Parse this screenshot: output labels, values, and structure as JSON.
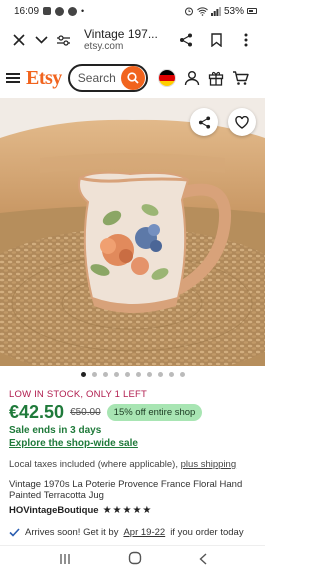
{
  "status_bar": {
    "time": "16:09",
    "battery": "53%"
  },
  "browser": {
    "page_title": "Vintage 197...",
    "url": "etsy.com"
  },
  "header": {
    "logo": "Etsy",
    "search_placeholder": "Search"
  },
  "gallery": {
    "dot_count": 10,
    "active_index": 0
  },
  "product": {
    "stock_notice": "LOW IN STOCK, ONLY 1 LEFT",
    "price": "€42.50",
    "original_price": "€50.00",
    "discount_badge": "15% off entire shop",
    "sale_ends": "Sale ends in 3 days",
    "explore_link": "Explore the shop-wide sale",
    "taxes_text": "Local taxes included (where applicable),",
    "shipping_link": "plus shipping",
    "title": "Vintage 1970s La Poterie Provence France Floral Hand Painted Terracotta Jug",
    "shop_name": "HOVintageBoutique",
    "stars": "★★★★★",
    "arrival_prefix": "Arrives soon! Get it by",
    "arrival_date": "Apr 19-22",
    "arrival_suffix": "if you order today"
  },
  "colors": {
    "etsy_orange": "#f1641e",
    "sale_green": "#1f7a3a",
    "stock_red": "#b11d4f",
    "badge_green": "#a8e5b3"
  }
}
